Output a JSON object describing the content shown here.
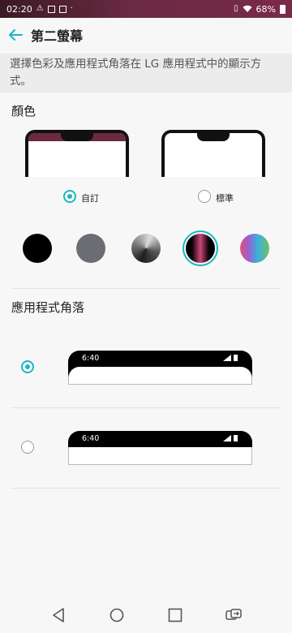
{
  "status_bar": {
    "time": "02:20",
    "battery": "68%"
  },
  "header": {
    "title": "第二螢幕"
  },
  "description": "選擇色彩及應用程式角落在 LG 應用程式中的顯示方式。",
  "color_section": {
    "title": "顏色",
    "options": [
      {
        "label": "自訂",
        "selected": true
      },
      {
        "label": "標準",
        "selected": false
      }
    ],
    "swatches": [
      {
        "name": "black",
        "selected": false
      },
      {
        "name": "gray",
        "selected": false
      },
      {
        "name": "dark-gradient",
        "selected": false
      },
      {
        "name": "burgundy",
        "selected": true
      },
      {
        "name": "rainbow",
        "selected": false
      }
    ],
    "accent_color": "#1cb5c2",
    "custom_bar_color": "#6a2a42"
  },
  "corner_section": {
    "title": "應用程式角落",
    "options": [
      {
        "type": "rounded",
        "selected": true,
        "preview_time": "6:40"
      },
      {
        "type": "square",
        "selected": false,
        "preview_time": "6:40"
      }
    ]
  },
  "nav_bar": {
    "buttons": [
      "back-icon",
      "home-icon",
      "recents-icon",
      "dual-screen-icon"
    ]
  }
}
